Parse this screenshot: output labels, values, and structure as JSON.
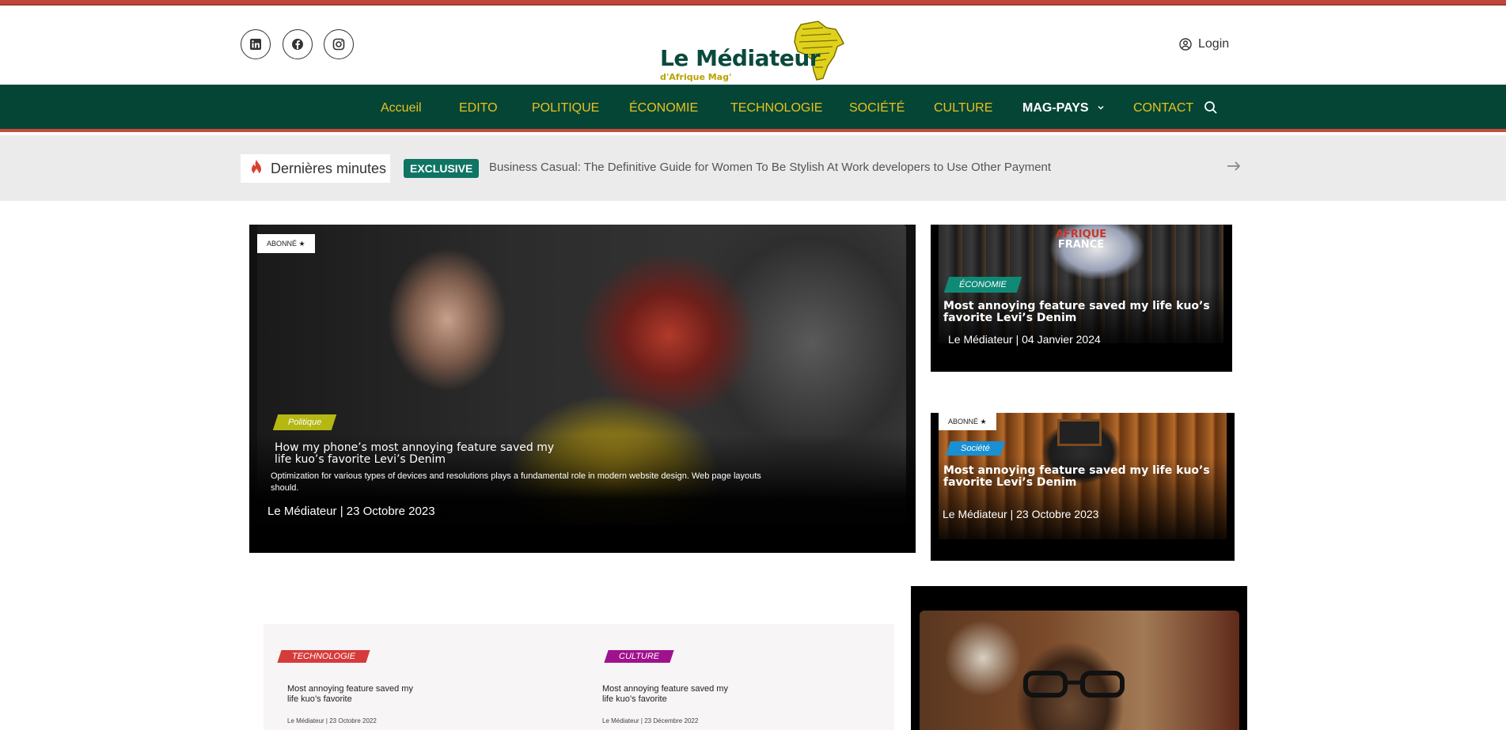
{
  "header": {
    "social": [
      {
        "name": "linkedin-icon"
      },
      {
        "name": "facebook-icon"
      },
      {
        "name": "instagram-icon"
      }
    ],
    "logo_title": "Le Médiateur",
    "logo_subtitle": "d'Afrique Mag'",
    "login_label": "Login"
  },
  "nav": {
    "items": [
      "Accueil",
      "EDITO",
      "POLITIQUE",
      "ÉCONOMIE",
      "TECHNOLOGIE",
      "SOCIÉTÉ",
      "CULTURE",
      "MAG-PAYS",
      "CONTACT"
    ],
    "active_color": "#e8c21e",
    "bg_color": "#054536"
  },
  "ticker": {
    "label": "Dernières minutes",
    "badge": "EXCLUSIVE",
    "headline": "Business Casual: The Definitive Guide for Women To Be Stylish At Work developers to Use Other Payment"
  },
  "hero": {
    "badge": "ABONNÉ",
    "category": "Politique",
    "title": "How my phone’s most annoying feature saved my life kuo’s favorite Levi’s Denim",
    "excerpt": "Optimization for various types of devices and resolutions plays a fundamental role in modern website design. Web page layouts should.",
    "meta": "Le Médiateur | 23 Octobre 2023"
  },
  "side_cards": [
    {
      "category": "ÉCONOMIE",
      "category_color": "#0f8a76",
      "title": "Most annoying feature saved my life kuo’s favorite Levi’s Denim",
      "meta": "Le Médiateur | 04 Janvier 2024",
      "image_text_line1": "AFRIQUE",
      "image_text_line2": "FRANCE"
    },
    {
      "badge": "ABONNÉ",
      "category": "Société",
      "category_color": "#1a8fd1",
      "title": "Most annoying feature saved my life kuo’s favorite Levi’s Denim",
      "meta": "Le Médiateur | 23 Octobre 2023"
    }
  ],
  "grid_cards": [
    {
      "category": "TECHNOLOGIE",
      "category_color": "#d63b3b",
      "title": "Most annoying feature saved my life kuo’s favorite",
      "meta": "Le Médiateur | 23 Octobre 2022"
    },
    {
      "category": "CULTURE",
      "category_color": "#a0118d",
      "title": "Most annoying feature saved my life kuo’s favorite",
      "meta": "Le Médiateur | 23 Décembre 2022"
    }
  ]
}
